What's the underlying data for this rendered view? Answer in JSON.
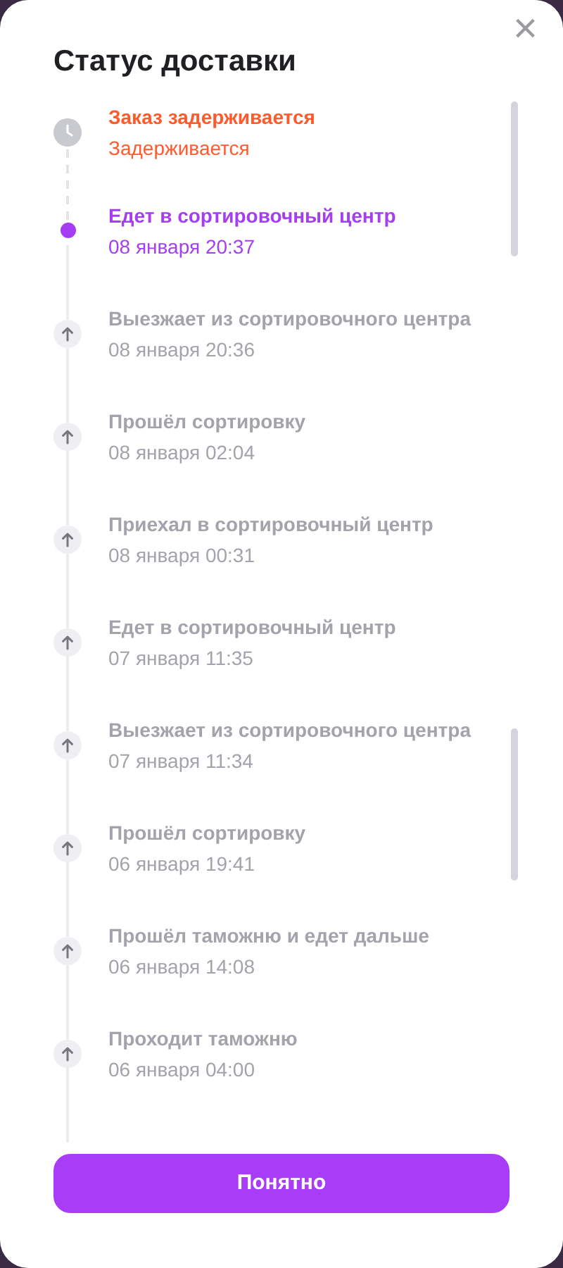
{
  "dialog": {
    "title": "Статус доставки",
    "close": "×"
  },
  "events": [
    {
      "kind": "delayed",
      "title": "Заказ задерживается",
      "subtitle": "Задерживается"
    },
    {
      "kind": "current",
      "title": "Едет в сортировочный центр",
      "subtitle": "08 января 20:37"
    },
    {
      "kind": "past",
      "title": "Выезжает из сортировочного центра",
      "subtitle": "08 января 20:36"
    },
    {
      "kind": "past",
      "title": "Прошёл сортировку",
      "subtitle": "08 января 02:04"
    },
    {
      "kind": "past",
      "title": "Приехал в сортировочный центр",
      "subtitle": "08 января 00:31"
    },
    {
      "kind": "past",
      "title": "Едет в сортировочный центр",
      "subtitle": "07 января 11:35"
    },
    {
      "kind": "past",
      "title": "Выезжает из сортировочного центра",
      "subtitle": "07 января 11:34"
    },
    {
      "kind": "past",
      "title": "Прошёл сортировку",
      "subtitle": "06 января 19:41"
    },
    {
      "kind": "past",
      "title": "Прошёл таможню и едет дальше",
      "subtitle": "06 января 14:08"
    },
    {
      "kind": "past",
      "title": "Проходит таможню",
      "subtitle": "06 января 04:00"
    }
  ],
  "button": "Понятно"
}
